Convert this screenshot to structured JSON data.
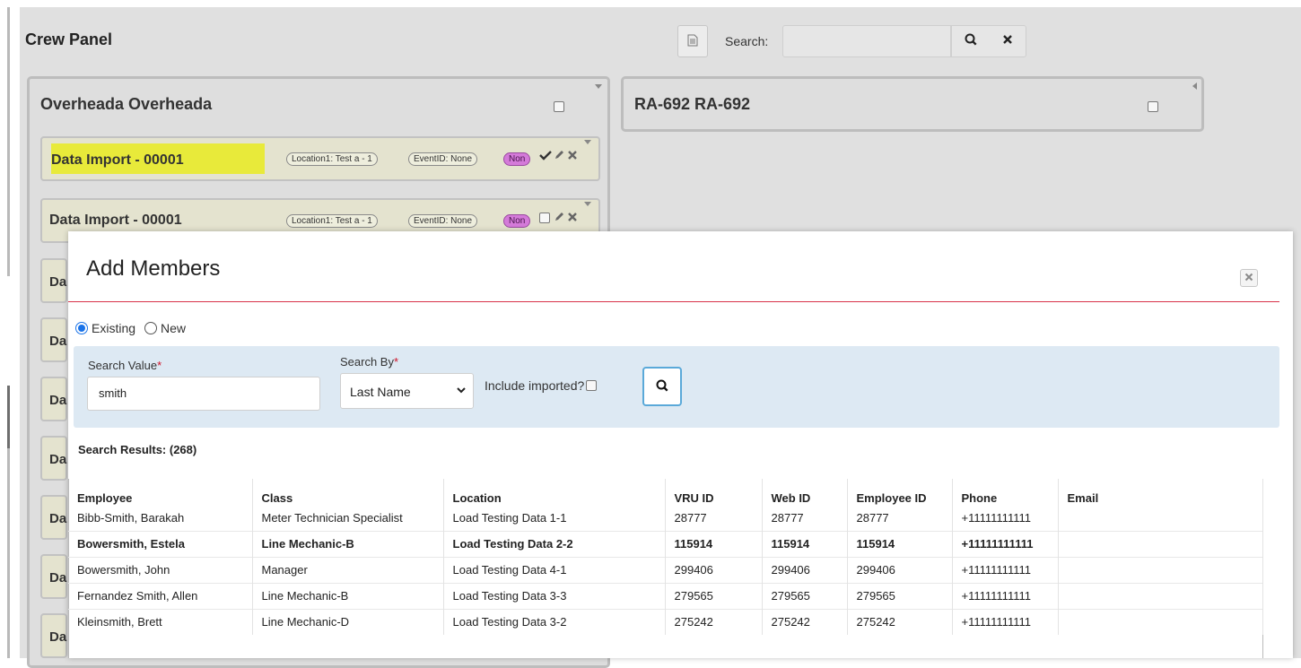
{
  "header": {
    "panel_title": "Crew Panel",
    "search_label": "Search:",
    "search_value": ""
  },
  "columns": {
    "left": {
      "title": "Overheada Overheada",
      "cards": [
        {
          "title": "Data Import - 00001",
          "highlight": true,
          "location": "Location1: Test a - 1",
          "event": "EventID: None",
          "badge": "Non"
        },
        {
          "title": "Data Import - 00001",
          "highlight": false,
          "location": "Location1: Test a - 1",
          "event": "EventID: None",
          "badge": "Non"
        }
      ],
      "stub_label": "Da"
    },
    "right": {
      "title": "RA-692 RA-692"
    }
  },
  "modal": {
    "title": "Add Members",
    "radios": {
      "existing": "Existing",
      "new": "New",
      "selected": "existing"
    },
    "search_value_label": "Search Value",
    "search_value": "smith",
    "search_by_label": "Search By",
    "search_by_value": "Last Name",
    "include_imported_label": "Include imported?",
    "results_label": "Search Results: (268)",
    "table": {
      "headers": [
        "Employee",
        "Class",
        "Location",
        "VRU ID",
        "Web ID",
        "Employee ID",
        "Phone",
        "Email"
      ],
      "rows": [
        [
          "Bibb-Smith, Barakah",
          "Meter Technician Specialist",
          "Load Testing Data 1-1",
          "28777",
          "28777",
          "28777",
          "+11111111111",
          ""
        ],
        [
          "Bowersmith, Estela",
          "Line Mechanic-B",
          "Load Testing Data 2-2",
          "115914",
          "115914",
          "115914",
          "+11111111111",
          ""
        ],
        [
          "Bowersmith, John",
          "Manager",
          "Load Testing Data 4-1",
          "299406",
          "299406",
          "299406",
          "+11111111111",
          ""
        ],
        [
          "Fernandez Smith, Allen",
          "Line Mechanic-B",
          "Load Testing Data 3-3",
          "279565",
          "279565",
          "279565",
          "+11111111111",
          ""
        ],
        [
          "Kleinsmith, Brett",
          "Line Mechanic-D",
          "Load Testing Data 3-2",
          "275242",
          "275242",
          "275242",
          "+11111111111",
          ""
        ]
      ]
    }
  },
  "colors": {
    "highlight": "#e8ea3a",
    "badge_non": "#d47ad9",
    "divider": "#d9334a",
    "search_panel": "#dde9f3",
    "accent": "#1a73e8"
  },
  "icons": [
    "document-icon",
    "search-icon",
    "close-icon",
    "check-icon",
    "pencil-icon",
    "delete-icon",
    "chevron-down-icon"
  ]
}
